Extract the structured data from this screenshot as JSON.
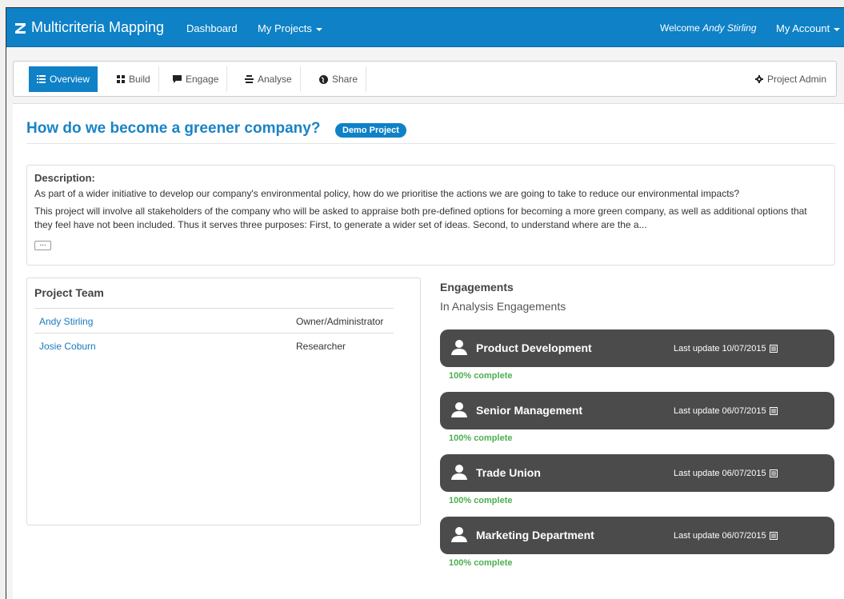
{
  "navbar": {
    "brand": "Multicriteria Mapping",
    "links": [
      "Dashboard",
      "My Projects"
    ],
    "welcome_prefix": "Welcome",
    "welcome_user": "Andy Stirling",
    "account": "My Account"
  },
  "tabs": [
    {
      "label": "Overview",
      "icon": "list-icon",
      "active": true
    },
    {
      "label": "Build",
      "icon": "grid-icon",
      "active": false
    },
    {
      "label": "Engage",
      "icon": "comment-icon",
      "active": false
    },
    {
      "label": "Analyse",
      "icon": "align-icon",
      "active": false
    },
    {
      "label": "Share",
      "icon": "globe-icon",
      "active": false
    }
  ],
  "admin_label": "Project Admin",
  "project": {
    "title": "How do we become a greener company?",
    "badge": "Demo Project"
  },
  "description": {
    "heading": "Description:",
    "paragraph1": "As part of a wider initiative to develop our company's environmental policy, how do we prioritise the actions we are going to take to reduce our environmental impacts?",
    "paragraph2": "This project will involve all stakeholders of the company who will be asked to appraise both pre-defined options for becoming a more green company, as well as additional options that they feel have not been included. Thus it serves three purposes: First, to generate a wider set of ideas. Second, to understand where are the a...",
    "more": "..."
  },
  "team": {
    "heading": "Project Team",
    "members": [
      {
        "name": "Andy Stirling",
        "role": "Owner/Administrator"
      },
      {
        "name": "Josie Coburn",
        "role": "Researcher"
      }
    ]
  },
  "engagements": {
    "heading": "Engagements",
    "subheading": "In Analysis Engagements",
    "items": [
      {
        "name": "Product Development",
        "update": "Last update 10/07/2015",
        "complete": "100% complete"
      },
      {
        "name": "Senior Management",
        "update": "Last update 06/07/2015",
        "complete": "100% complete"
      },
      {
        "name": "Trade Union",
        "update": "Last update 06/07/2015",
        "complete": "100% complete"
      },
      {
        "name": "Marketing Department",
        "update": "Last update 06/07/2015",
        "complete": "100% complete"
      }
    ]
  },
  "colors": {
    "primary": "#0e81c7",
    "card": "#4b4b4b",
    "success": "#4caf50"
  }
}
